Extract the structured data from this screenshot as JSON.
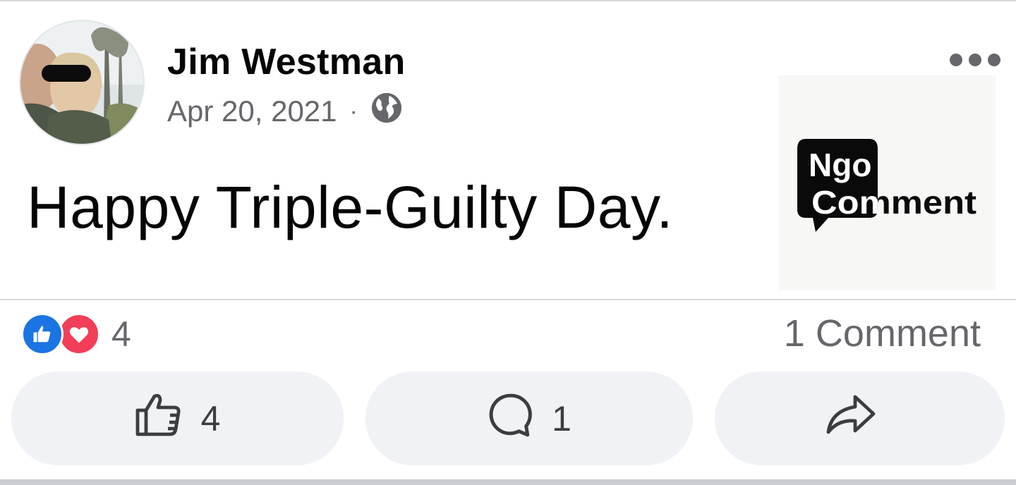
{
  "post": {
    "author": "Jim Westman",
    "date": "Apr 20, 2021",
    "separator": "·",
    "privacy_icon": "globe-icon",
    "text": "Happy Triple-Guilty Day.",
    "menu_icon": "more-options-icon"
  },
  "watermark": {
    "line1": "Ngo",
    "line2": "Comment"
  },
  "reactions": {
    "icons": [
      "like-reaction-icon",
      "love-reaction-icon"
    ],
    "count": "4",
    "comments_summary": "1 Comment"
  },
  "actions": {
    "like_count": "4",
    "comment_count": "1",
    "share_label": ""
  },
  "colors": {
    "like_blue": "#1b74e4",
    "love_red": "#f33e58",
    "secondary_text": "#65676b",
    "button_bg": "#f0f2f5"
  }
}
